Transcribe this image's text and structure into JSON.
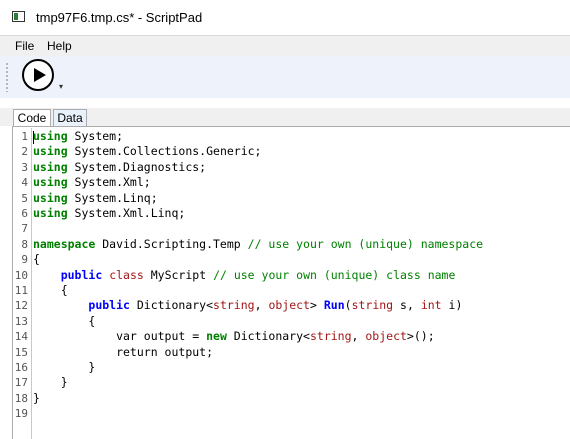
{
  "window": {
    "title": "tmp97F6.tmp.cs* - ScriptPad"
  },
  "menu": {
    "file": "File",
    "help": "Help"
  },
  "toolbar": {
    "run_icon": "play-icon",
    "overflow_icon": "chevron-down-icon"
  },
  "tabs": {
    "code": "Code",
    "data": "Data"
  },
  "editor": {
    "line_numbers": [
      "1",
      "2",
      "3",
      "4",
      "5",
      "6",
      "7",
      "8",
      "9",
      "10",
      "11",
      "12",
      "13",
      "14",
      "15",
      "16",
      "17",
      "18",
      "19"
    ],
    "lines": [
      [
        {
          "t": "using",
          "c": "kw2"
        },
        {
          "t": " System;"
        }
      ],
      [
        {
          "t": "using",
          "c": "kw2"
        },
        {
          "t": " System.Collections.Generic;"
        }
      ],
      [
        {
          "t": "using",
          "c": "kw2"
        },
        {
          "t": " System.Diagnostics;"
        }
      ],
      [
        {
          "t": "using",
          "c": "kw2"
        },
        {
          "t": " System.Xml;"
        }
      ],
      [
        {
          "t": "using",
          "c": "kw2"
        },
        {
          "t": " System.Linq;"
        }
      ],
      [
        {
          "t": "using",
          "c": "kw2"
        },
        {
          "t": " System.Xml.Linq;"
        }
      ],
      [],
      [
        {
          "t": "namespace",
          "c": "kw2"
        },
        {
          "t": " David.Scripting.Temp "
        },
        {
          "t": "// use your own (unique) namespace",
          "c": "cm"
        }
      ],
      [
        {
          "t": "{"
        }
      ],
      [
        {
          "t": "    "
        },
        {
          "t": "public",
          "c": "kw"
        },
        {
          "t": " "
        },
        {
          "t": "class",
          "c": "str"
        },
        {
          "t": " MyScript "
        },
        {
          "t": "// use your own (unique) class name",
          "c": "cm"
        }
      ],
      [
        {
          "t": "    {"
        }
      ],
      [
        {
          "t": "        "
        },
        {
          "t": "public",
          "c": "kw"
        },
        {
          "t": " Dictionary<"
        },
        {
          "t": "string",
          "c": "str"
        },
        {
          "t": ", "
        },
        {
          "t": "object",
          "c": "str"
        },
        {
          "t": "> "
        },
        {
          "t": "Run",
          "c": "kw"
        },
        {
          "t": "("
        },
        {
          "t": "string",
          "c": "str"
        },
        {
          "t": " s, "
        },
        {
          "t": "int",
          "c": "str"
        },
        {
          "t": " i)"
        }
      ],
      [
        {
          "t": "        {"
        }
      ],
      [
        {
          "t": "            var output = "
        },
        {
          "t": "new",
          "c": "kw2"
        },
        {
          "t": " Dictionary<"
        },
        {
          "t": "string",
          "c": "str"
        },
        {
          "t": ", "
        },
        {
          "t": "object",
          "c": "str"
        },
        {
          "t": ">();"
        }
      ],
      [
        {
          "t": "            return output;"
        }
      ],
      [
        {
          "t": "        }"
        }
      ],
      [
        {
          "t": "    }"
        }
      ],
      [
        {
          "t": "}"
        }
      ],
      []
    ]
  }
}
